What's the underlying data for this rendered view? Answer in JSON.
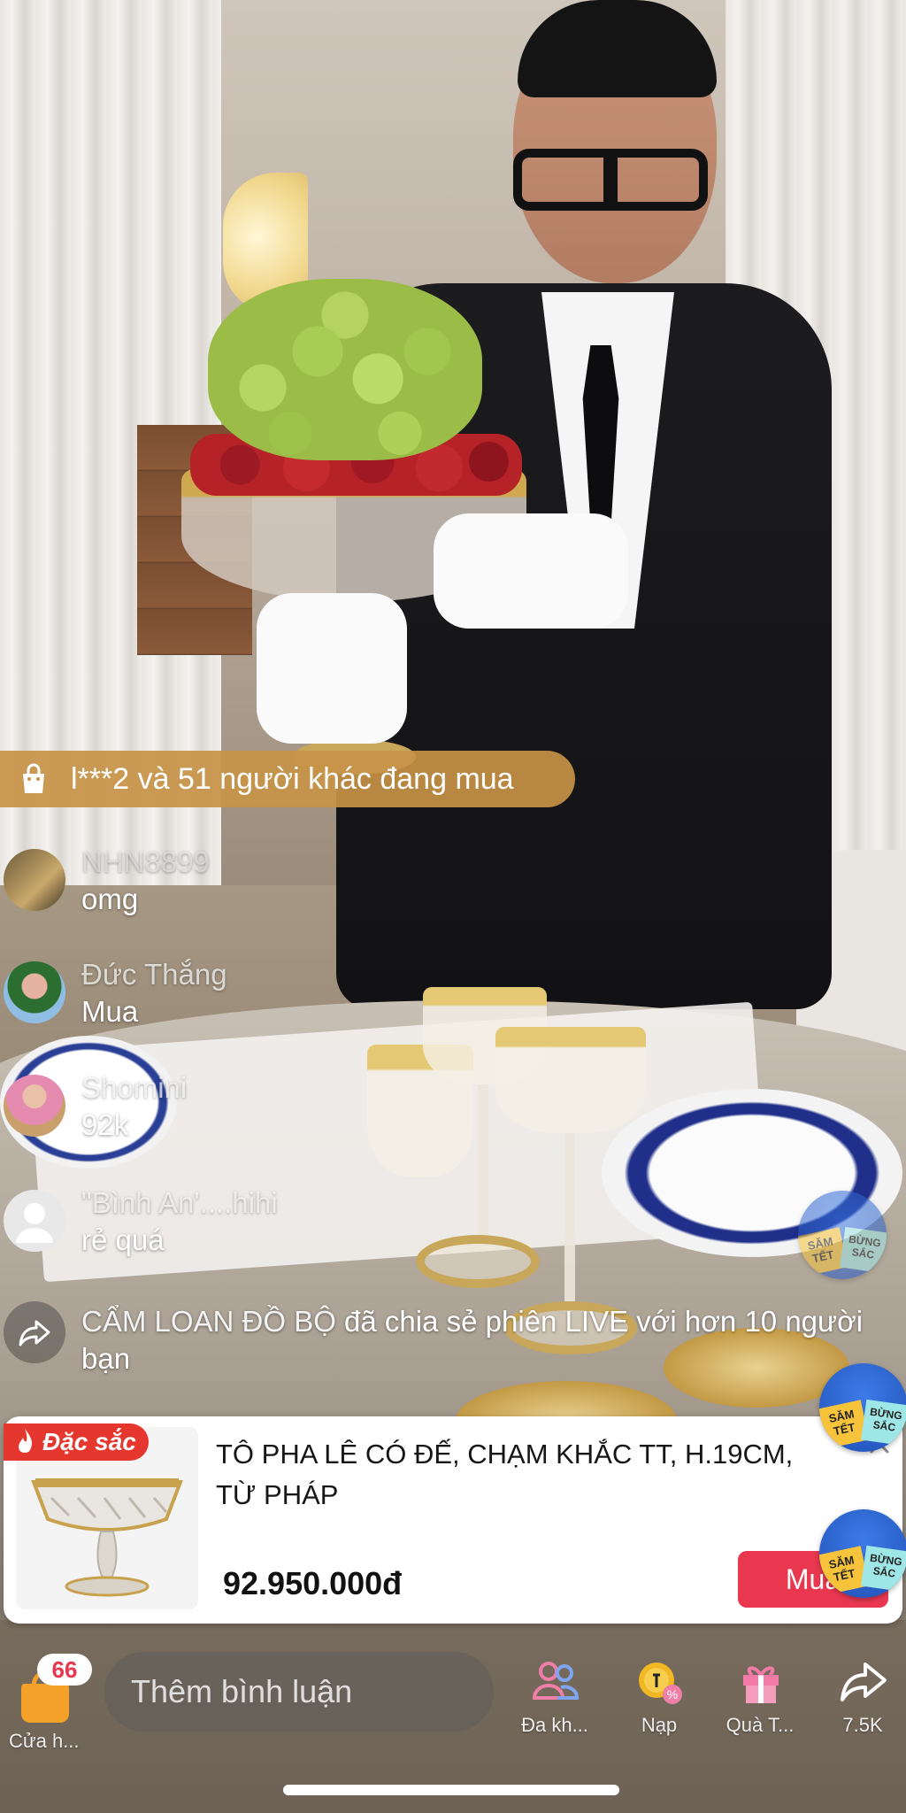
{
  "buying_banner": {
    "text": "l***2 và 51 người khác đang mua"
  },
  "comments": [
    {
      "name": "NHN8899",
      "text": "omg"
    },
    {
      "name": "Đức Thắng",
      "text": "Mua"
    },
    {
      "name": "Shomini",
      "text": "92k"
    },
    {
      "name": "\"Bình An'....hihi",
      "text": "rẻ quá"
    }
  ],
  "share_event": {
    "user": "CẨM LOAN ĐỒ BỘ",
    "message": " đã chia sẻ phiên LIVE với hơn 10 người bạn"
  },
  "product": {
    "badge": "Đặc sắc",
    "title": "TÔ PHA LÊ CÓ ĐẾ, CHẠM KHẮC TT, H.19CM, TỪ PHÁP",
    "price": "92.950.000đ",
    "buy_label": "Mua"
  },
  "promo_badge": {
    "line1": "SĂM TẾT",
    "line2": "BỪNG SẮC"
  },
  "bottom_bar": {
    "shop_count": "66",
    "shop_label": "Cửa h...",
    "comment_placeholder": "Thêm bình luận",
    "multi_guest_label": "Đa kh...",
    "topup_label": "Nạp",
    "gift_label": "Quà T...",
    "share_count": "7.5K"
  },
  "colors": {
    "accent_red": "#e8374f",
    "banner_gold": "#c79248",
    "badge_red": "#e5372e"
  }
}
